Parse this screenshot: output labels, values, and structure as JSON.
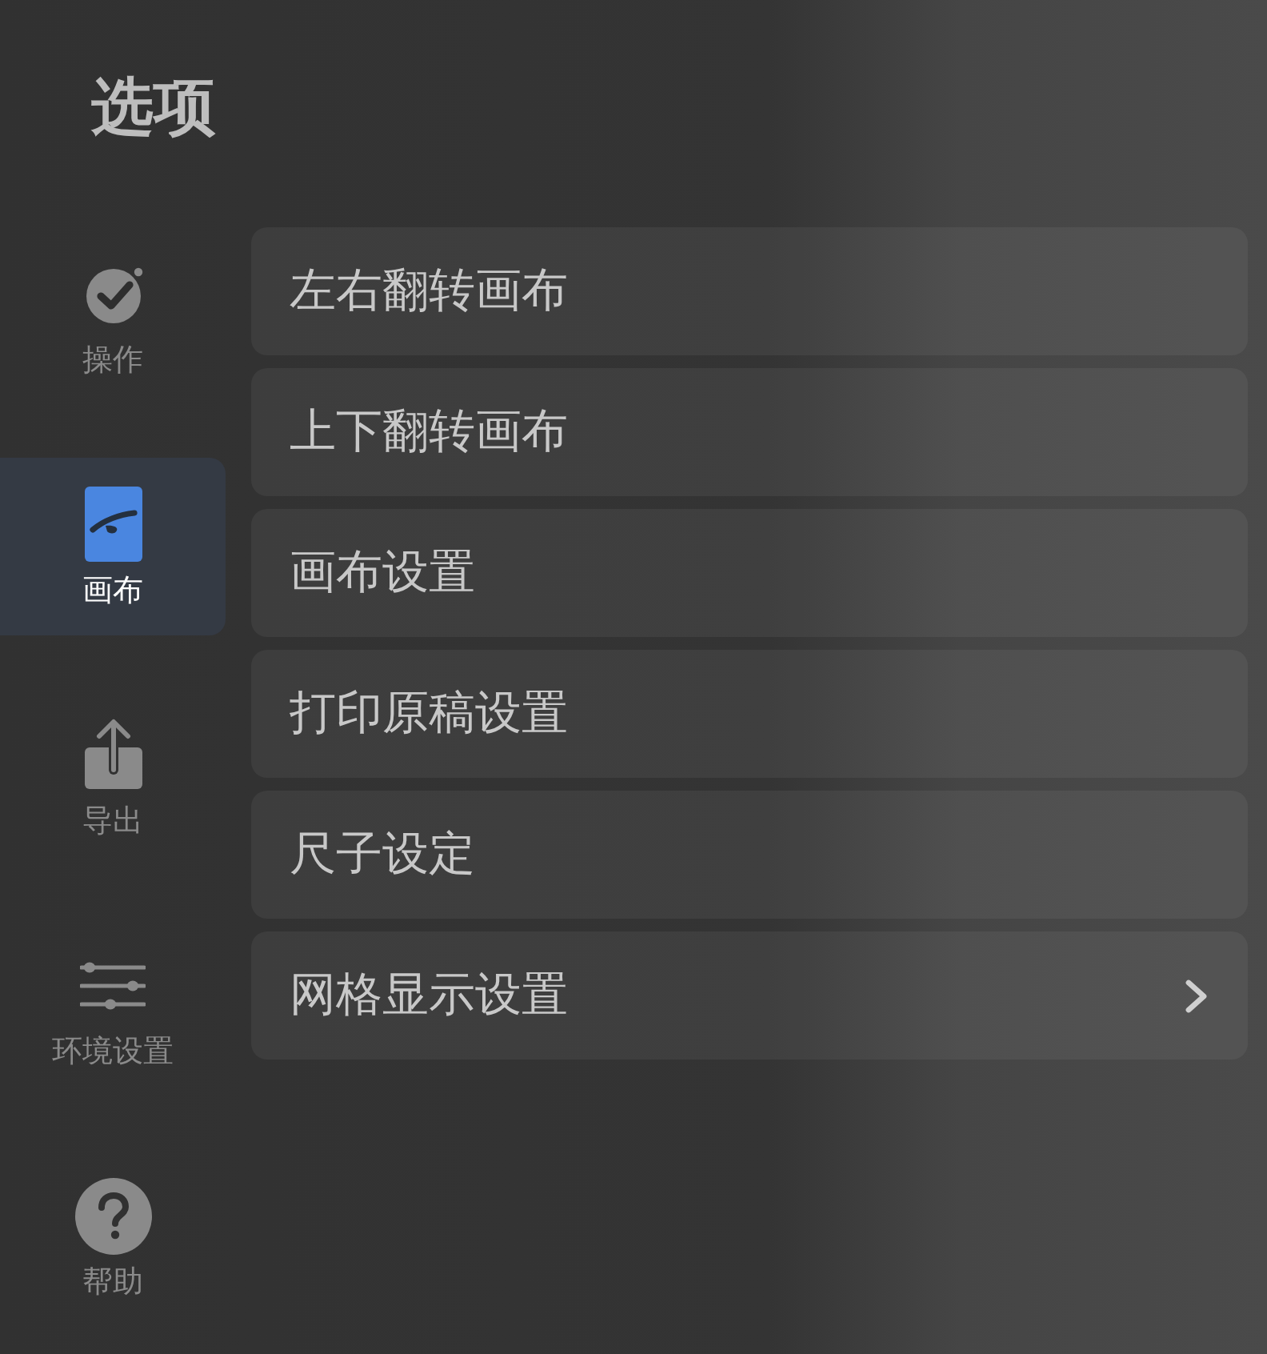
{
  "title": "选项",
  "sidebar": {
    "items": [
      {
        "label": "操作",
        "kind": "check",
        "selected": false
      },
      {
        "label": "画布",
        "kind": "canvas",
        "selected": true
      },
      {
        "label": "导出",
        "kind": "export",
        "selected": false
      },
      {
        "label": "环境设置",
        "kind": "sliders",
        "selected": false
      },
      {
        "label": "帮助",
        "kind": "help",
        "selected": false
      }
    ]
  },
  "menu": {
    "items": [
      {
        "label": "左右翻转画布",
        "has_submenu": false
      },
      {
        "label": "上下翻转画布",
        "has_submenu": false
      },
      {
        "label": "画布设置",
        "has_submenu": false
      },
      {
        "label": "打印原稿设置",
        "has_submenu": false
      },
      {
        "label": "尺子设定",
        "has_submenu": false
      },
      {
        "label": "网格显示设置",
        "has_submenu": true
      }
    ]
  }
}
